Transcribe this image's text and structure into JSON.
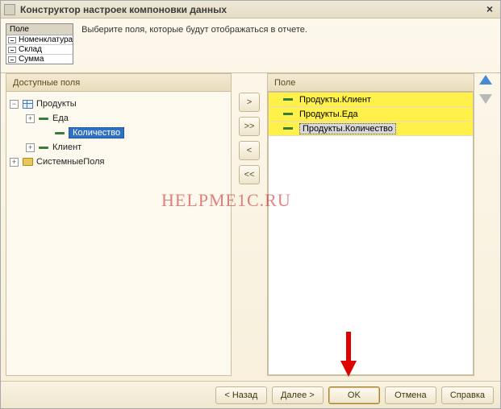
{
  "window": {
    "title": "Конструктор настроек компоновки данных"
  },
  "miniTable": {
    "header": "Поле",
    "rows": [
      "Номенклатура",
      "Склад",
      "Сумма"
    ]
  },
  "instruction": "Выберите поля, которые будут отображаться в отчете.",
  "leftPanel": {
    "title": "Доступные поля",
    "tree": {
      "root1": {
        "label": "Продукты",
        "expanded": true
      },
      "child_eda": {
        "label": "Еда"
      },
      "child_kol": {
        "label": "Количество"
      },
      "child_klient": {
        "label": "Клиент"
      },
      "root2": {
        "label": "СистемныеПоля"
      }
    }
  },
  "midButtons": {
    "add": ">",
    "addAll": ">>",
    "remove": "<",
    "removeAll": "<<"
  },
  "rightPanel": {
    "title": "Поле",
    "rows": [
      {
        "label": "Продукты.Клиент",
        "highlighted": true,
        "selected": false
      },
      {
        "label": "Продукты.Еда",
        "highlighted": true,
        "selected": false
      },
      {
        "label": "Продукты.Количество",
        "highlighted": true,
        "selected": true
      }
    ]
  },
  "footer": {
    "back": "< Назад",
    "next": "Далее >",
    "ok": "OK",
    "cancel": "Отмена",
    "help": "Справка"
  },
  "watermark": "HELPME1C.RU"
}
